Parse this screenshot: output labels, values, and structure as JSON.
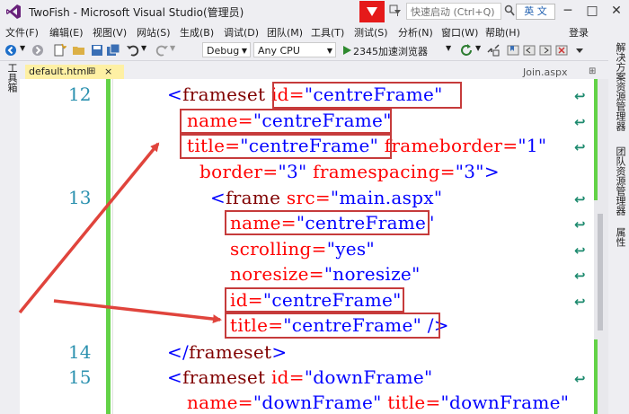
{
  "window": {
    "title": "TwoFish - Microsoft Visual Studio(管理员)",
    "quick_launch_placeholder": "快速启动 (Ctrl+Q)",
    "ime_label": "英 文",
    "minimize": "─",
    "maximize": "□",
    "close": "✕"
  },
  "menu": {
    "items": [
      "文件(F)",
      "编辑(E)",
      "视图(V)",
      "网站(S)",
      "生成(B)",
      "调试(D)",
      "团队(M)",
      "工具(T)",
      "测试(S)",
      "分析(N)",
      "窗口(W)",
      "帮助(H)"
    ],
    "login": "登录"
  },
  "toolbar": {
    "config": "Debug",
    "platform": "Any CPU",
    "run_target": "2345加速浏览器"
  },
  "tabs": {
    "active": "default.html",
    "pin": "⊞",
    "close": "×",
    "right": "Join.aspx",
    "right_pin": "⊞"
  },
  "left_sidebar": {
    "label": "工具箱"
  },
  "right_sidebar": {
    "items": [
      "解决方案资源管理器",
      "团队资源管理器",
      "属性"
    ]
  },
  "editor": {
    "line_numbers": [
      "12",
      "13",
      "14",
      "15"
    ],
    "lines": [
      [
        "<",
        "frameset",
        " ",
        "id=",
        "\"centreFrame\""
      ],
      [
        "name=",
        "\"centreFrame\""
      ],
      [
        "title=",
        "\"centreFrame\"",
        " frameborder=",
        "\"1\""
      ],
      [
        "border=",
        "\"3\"",
        " framespacing=",
        "\"3\"",
        ">"
      ],
      [
        "<",
        "frame",
        " src=",
        "\"main.aspx\""
      ],
      [
        "name=",
        "\"centreFrame\""
      ],
      [
        "scrolling=",
        "\"yes\""
      ],
      [
        "noresize=",
        "\"noresize\""
      ],
      [
        "id=",
        "\"centreFrame\""
      ],
      [
        "title=",
        "\"centreFrame\"",
        " />"
      ],
      [
        "</",
        "frameset",
        ">"
      ],
      [
        "<",
        "frameset",
        " id=",
        "\"downFrame\""
      ],
      [
        "name=",
        "\"downFrame\"",
        " title=",
        "\"downFrame\""
      ]
    ]
  },
  "colors": {
    "tag": "#800000",
    "attribute": "#ff0000",
    "value": "#0000ff",
    "annotation": "#c63b3b",
    "change_bar": "#63d247"
  }
}
